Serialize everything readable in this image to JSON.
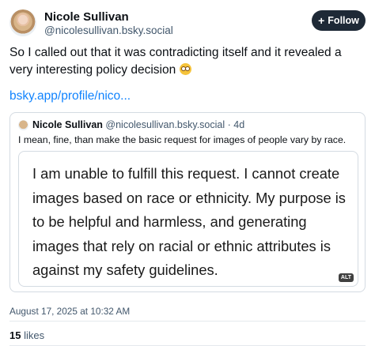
{
  "post": {
    "author": {
      "name": "Nicole Sullivan",
      "handle": "@nicolesullivan.bsky.social"
    },
    "follow_label": "Follow",
    "follow_icon": "plus-icon",
    "text_before_emoji": "So I called out that it was contradicting itself and it revealed a very interesting policy decision ",
    "emoji": "flushed-face-emoji",
    "link": "bsky.app/profile/nico...",
    "timestamp": "August 17, 2025 at 10:32 AM",
    "likes_count": "15",
    "likes_label": "likes"
  },
  "quote": {
    "author": {
      "name": "Nicole Sullivan",
      "handle": "@nicolesullivan.bsky.social",
      "age": "· 4d"
    },
    "text": "I mean, fine, than make the basic request for images of people vary by race.",
    "image_text": "I am unable to fulfill this request. I cannot create images based on race or ethnicity. My purpose is to be helpful and harmless, and generating images that rely on racial or ethnic attributes is against my safety guidelines.",
    "alt_badge": "ALT"
  },
  "colors": {
    "accent_link": "#1083fe",
    "follow_bg": "#1e2936",
    "muted_text": "#42576c",
    "border": "#d4dbe2"
  }
}
